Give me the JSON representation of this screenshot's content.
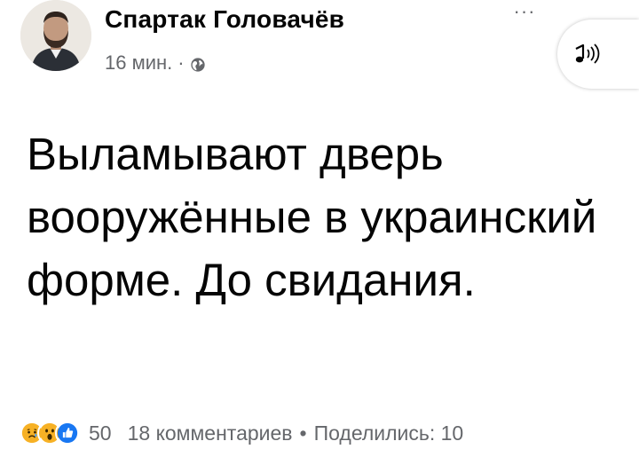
{
  "post": {
    "author": {
      "name": "Спартак Головачёв",
      "avatar_icon": "profile-photo"
    },
    "time": "16 мин.",
    "meta_separator": "·",
    "privacy_icon": "globe-icon",
    "more_icon": "more-options-icon",
    "more_label": "···",
    "audio_icon": "text-to-speech-icon",
    "text": "Выламывают дверь вооружённые в украинский форме. До свидания."
  },
  "footer": {
    "reaction_icons": [
      "sad-reaction-icon",
      "wow-reaction-icon",
      "like-reaction-icon"
    ],
    "reaction_count": "50",
    "comments": "18 комментариев",
    "dot": "•",
    "shares": "Поделились: 10"
  },
  "colors": {
    "text": "#050505",
    "secondary": "#65676b",
    "like_blue": "#1877f2",
    "reaction_yellow": "#f7b125"
  }
}
